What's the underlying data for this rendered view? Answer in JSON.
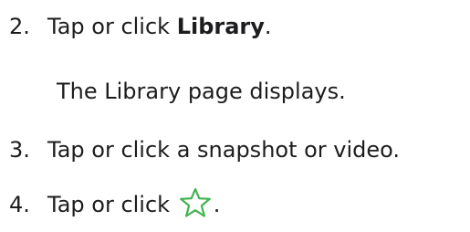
{
  "steps": [
    {
      "number": "2.",
      "text_before": "Tap or click ",
      "bold": "Library",
      "text_after": "."
    },
    {
      "note": "The Library page displays."
    },
    {
      "number": "3.",
      "text": "Tap or click a snapshot or video."
    },
    {
      "number": "4.",
      "text_before": "Tap or click ",
      "icon": "star-outline-icon",
      "text_after": "."
    }
  ],
  "colors": {
    "text": "#1d1d1f",
    "star_outline": "#3fb34f"
  }
}
